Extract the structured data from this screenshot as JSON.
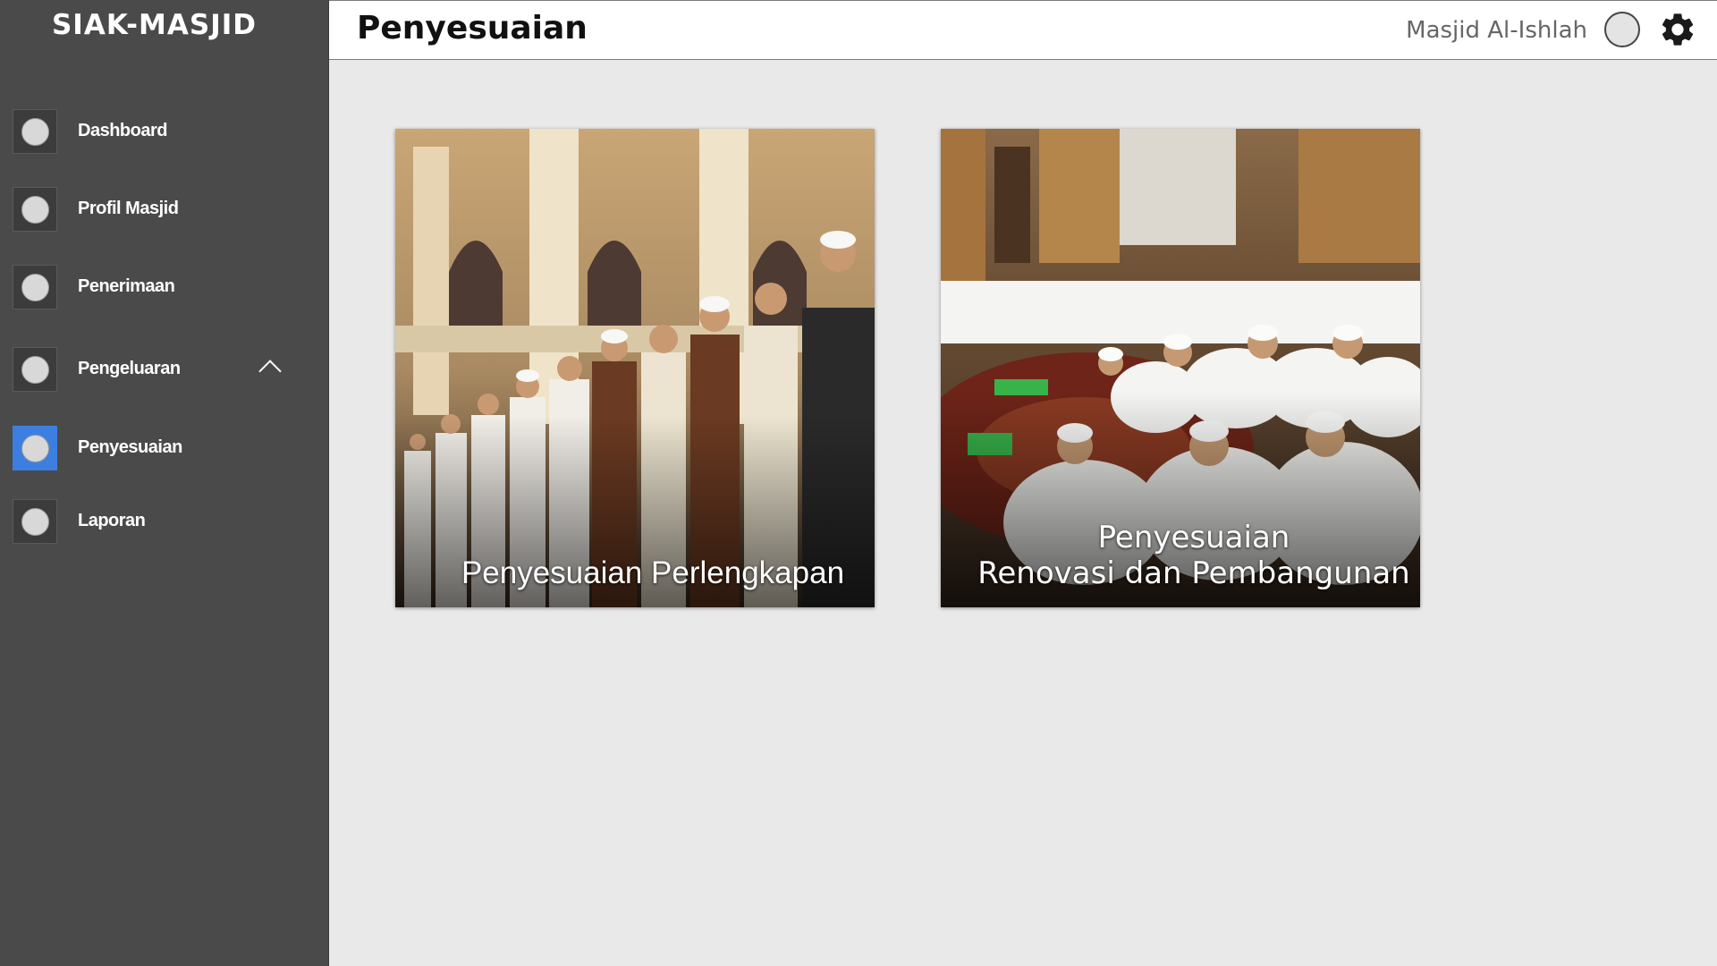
{
  "app": {
    "brand": "SIAK-MASJID"
  },
  "sidebar": {
    "items": [
      {
        "label": "Dashboard"
      },
      {
        "label": "Profil Masjid"
      },
      {
        "label": "Penerimaan"
      },
      {
        "label": "Pengeluaran"
      },
      {
        "label": "Penyesuaian"
      },
      {
        "label": "Laporan"
      }
    ],
    "active_item": "Penyesuaian",
    "expanded_item": "Pengeluaran"
  },
  "header": {
    "title": "Penyesuaian",
    "org_name": "Masjid Al-Ishlah",
    "settings_icon": "gear-icon",
    "avatar_icon": "user-avatar"
  },
  "cards": [
    {
      "label": "Penyesuaian Perlengkapan",
      "image": "mosque-congregation-prayer-photo"
    },
    {
      "label_line1": "Penyesuaian",
      "label_line2": "Renovasi dan Pembangunan",
      "image": "mosque-gathering-photo"
    }
  ],
  "colors": {
    "sidebar_bg": "#4a4a4a",
    "active_accent": "#3d7fe0",
    "main_bg": "#e9e9e9",
    "header_bg": "#ffffff"
  }
}
